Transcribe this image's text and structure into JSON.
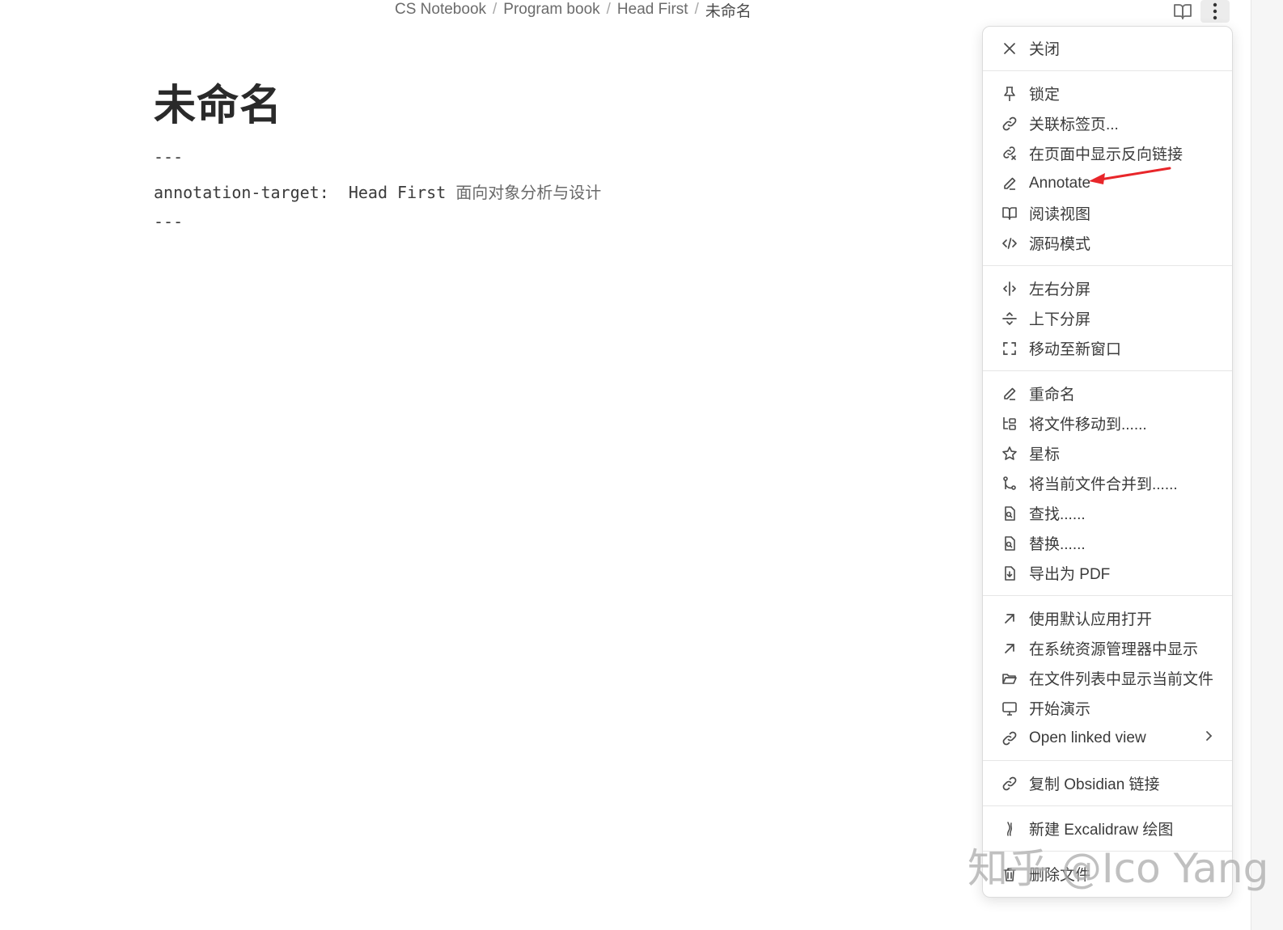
{
  "breadcrumb": {
    "items": [
      "CS Notebook",
      "Program book",
      "Head First"
    ],
    "separator": "/",
    "current": "未命名"
  },
  "header_icons": [
    "book-open-icon",
    "more-vertical-icon"
  ],
  "document": {
    "title": "未命名",
    "frontmatter_open": "---",
    "frontmatter_key": "annotation-target:",
    "frontmatter_value_en": "Head First",
    "frontmatter_value_cn": "面向对象分析与设计",
    "frontmatter_close": "---"
  },
  "menu": {
    "close": "关闭",
    "group1": [
      "锁定",
      "关联标签页...",
      "在页面中显示反向链接",
      "Annotate",
      "阅读视图",
      "源码模式"
    ],
    "group2": [
      "左右分屏",
      "上下分屏",
      "移动至新窗口"
    ],
    "group3": [
      "重命名",
      "将文件移动到......",
      "星标",
      "将当前文件合并到......",
      "查找......",
      "替换......",
      "导出为 PDF"
    ],
    "group4": [
      "使用默认应用打开",
      "在系统资源管理器中显示",
      "在文件列表中显示当前文件",
      "开始演示",
      "Open linked view"
    ],
    "group5": [
      "复制 Obsidian 链接"
    ],
    "group6": [
      "新建 Excalidraw 绘图"
    ],
    "group7": [
      "删除文件"
    ]
  },
  "annotation_arrow_color": "#e8262a",
  "watermark": "知乎 @Ico Yang"
}
